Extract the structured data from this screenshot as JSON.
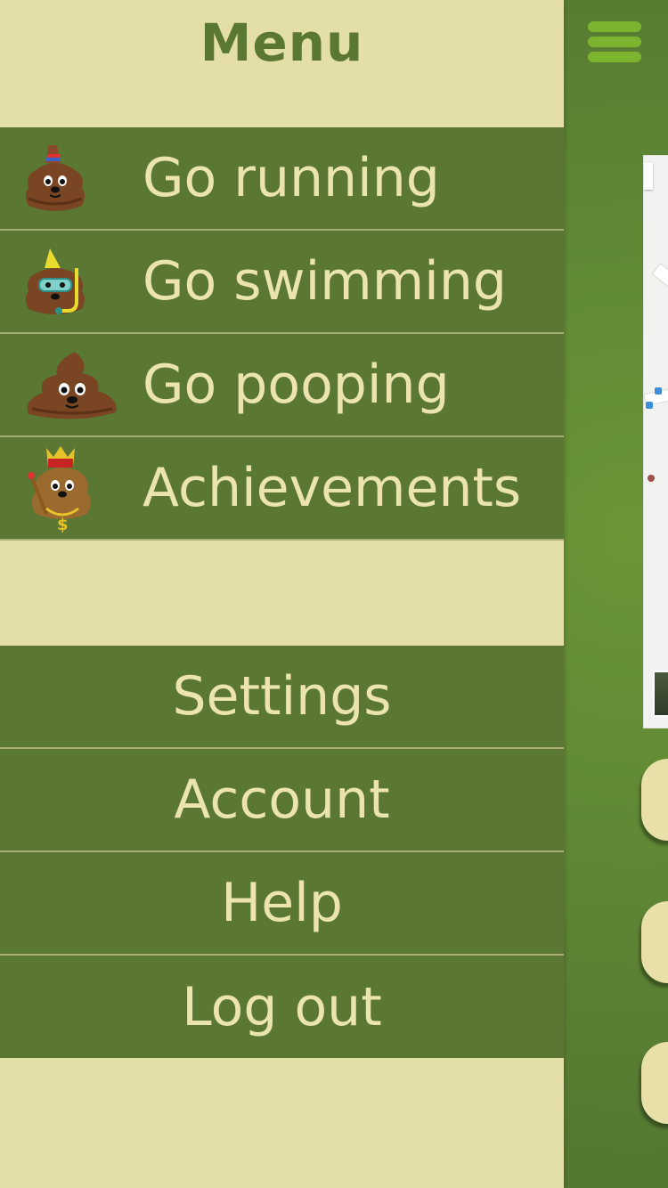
{
  "drawer": {
    "title": "Menu",
    "primary_items": [
      {
        "label": "Go running",
        "icon": "poop-partyhat-icon"
      },
      {
        "label": "Go swimming",
        "icon": "poop-snorkel-icon"
      },
      {
        "label": "Go pooping",
        "icon": "poop-icon"
      },
      {
        "label": "Achievements",
        "icon": "poop-king-icon"
      }
    ],
    "secondary_items": [
      {
        "label": "Settings"
      },
      {
        "label": "Account"
      },
      {
        "label": "Help"
      },
      {
        "label": "Log out"
      }
    ]
  },
  "background": {
    "menu_icon": "hamburger-icon",
    "map_icon": "map-icon"
  },
  "colors": {
    "drawer_bg": "#e4dfa8",
    "item_bg": "#5a7734",
    "item_text": "#ece4b0",
    "title_text": "#5a7734",
    "hamburger": "#7cb32f"
  }
}
